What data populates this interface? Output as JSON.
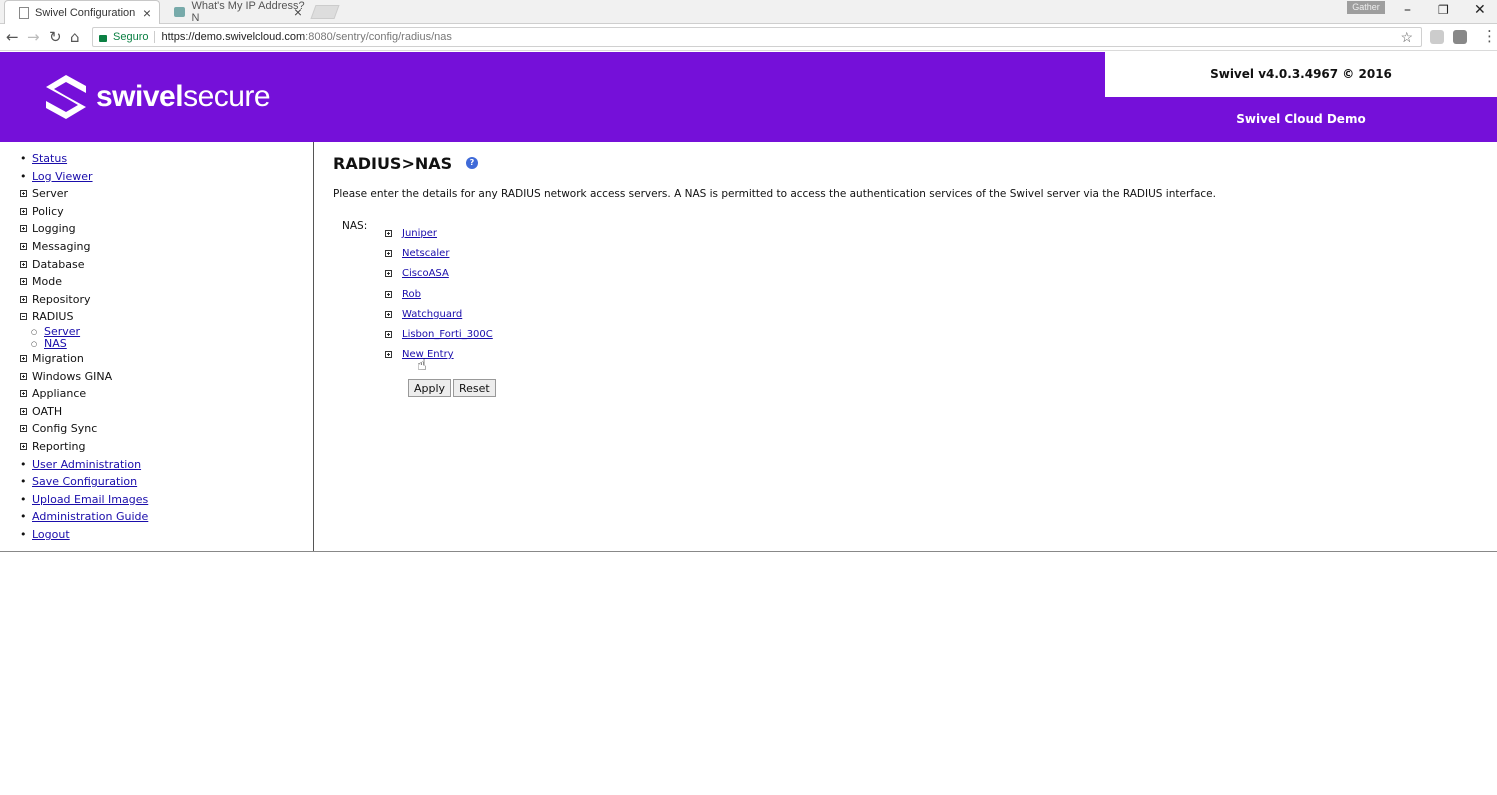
{
  "browser": {
    "tabs": [
      {
        "title": "Swivel Configuration",
        "active": true
      },
      {
        "title": "What's My IP Address? N",
        "active": false
      }
    ],
    "profile_badge": "Gather",
    "address": {
      "secure_label": "Seguro",
      "url_host": "https://demo.swivelcloud.com",
      "url_path": ":8080/sentry/config/radius/nas"
    }
  },
  "header": {
    "logo_text_bold": "swivel",
    "logo_text_light": "secure",
    "version": "Swivel v4.0.3.4967 © 2016",
    "instance_name": "Swivel Cloud Demo",
    "brand_color": "#7510d9"
  },
  "sidebar": {
    "items": [
      {
        "label": "Status",
        "type": "link"
      },
      {
        "label": "Log Viewer",
        "type": "link"
      },
      {
        "label": "Server",
        "type": "expandable"
      },
      {
        "label": "Policy",
        "type": "expandable"
      },
      {
        "label": "Logging",
        "type": "expandable"
      },
      {
        "label": "Messaging",
        "type": "expandable"
      },
      {
        "label": "Database",
        "type": "expandable"
      },
      {
        "label": "Mode",
        "type": "expandable"
      },
      {
        "label": "Repository",
        "type": "expandable"
      },
      {
        "label": "RADIUS",
        "type": "expanded"
      },
      {
        "label": "Server",
        "type": "sublink"
      },
      {
        "label": "NAS",
        "type": "sublink"
      },
      {
        "label": "Migration",
        "type": "expandable"
      },
      {
        "label": "Windows GINA",
        "type": "expandable"
      },
      {
        "label": "Appliance",
        "type": "expandable"
      },
      {
        "label": "OATH",
        "type": "expandable"
      },
      {
        "label": "Config Sync",
        "type": "expandable"
      },
      {
        "label": "Reporting",
        "type": "expandable"
      },
      {
        "label": "User Administration",
        "type": "link"
      },
      {
        "label": "Save Configuration",
        "type": "link"
      },
      {
        "label": "Upload Email Images",
        "type": "link"
      },
      {
        "label": "Administration Guide",
        "type": "link"
      },
      {
        "label": "Logout",
        "type": "link"
      }
    ]
  },
  "main": {
    "title": "RADIUS>NAS",
    "intro": "Please enter the details for any RADIUS network access servers. A NAS is permitted to access the authentication services of the Swivel server via the RADIUS interface.",
    "nas_label": "NAS:",
    "nas_entries": [
      "Juniper",
      "Netscaler",
      "CiscoASA",
      "Rob",
      "Watchguard",
      "Lisbon_Forti_300C",
      "New Entry"
    ],
    "apply_label": "Apply",
    "reset_label": "Reset"
  }
}
